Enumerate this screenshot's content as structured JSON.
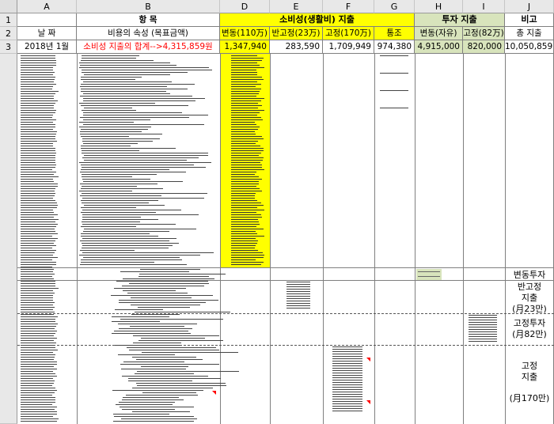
{
  "columns": [
    "A",
    "B",
    "D",
    "E",
    "F",
    "G",
    "H",
    "I",
    "J"
  ],
  "rows": [
    "1",
    "2",
    "3"
  ],
  "header_row1": {
    "item": "항  목",
    "consumption": "소비성(생활비) 지출",
    "investment": "투자 지출",
    "remark": "비고"
  },
  "header_row2": {
    "date": "날 짜",
    "attribute": "비용의 속성 (목표금액)",
    "variable": "변동(110万)",
    "semi_fixed": "반고정(23万)",
    "fixed": "고정(170万)",
    "communication": "통조",
    "inv_variable": "변동(자유)",
    "inv_fixed": "고정(82万)",
    "total": "총 지출"
  },
  "row3": {
    "date": "2018년 1월",
    "summary": "소비성 지출의 합계-->4,315,859원",
    "variable": "1,347,940",
    "semi_fixed": "283,590",
    "fixed": "1,709,949",
    "communication": "974,380",
    "inv_variable": "4,915,000",
    "inv_fixed": "820,000",
    "total": "10,050,859"
  },
  "remarks": {
    "variable_investment": "변동투자",
    "semi_fixed_line1": "반고정",
    "semi_fixed_line2": "지출",
    "semi_fixed_line3": "(月23만)",
    "fixed_investment_line1": "고정투자",
    "fixed_investment_line2": "(月82만)",
    "fixed_expense_line1": "고정",
    "fixed_expense_line2": "지출",
    "fixed_expense_line3": "(月170만)"
  },
  "colors": {
    "header_bg": "#e8e8e8",
    "highlight_yellow": "#ffff00",
    "investment_green": "#d8e4bc",
    "summary_red": "#ff0000"
  }
}
